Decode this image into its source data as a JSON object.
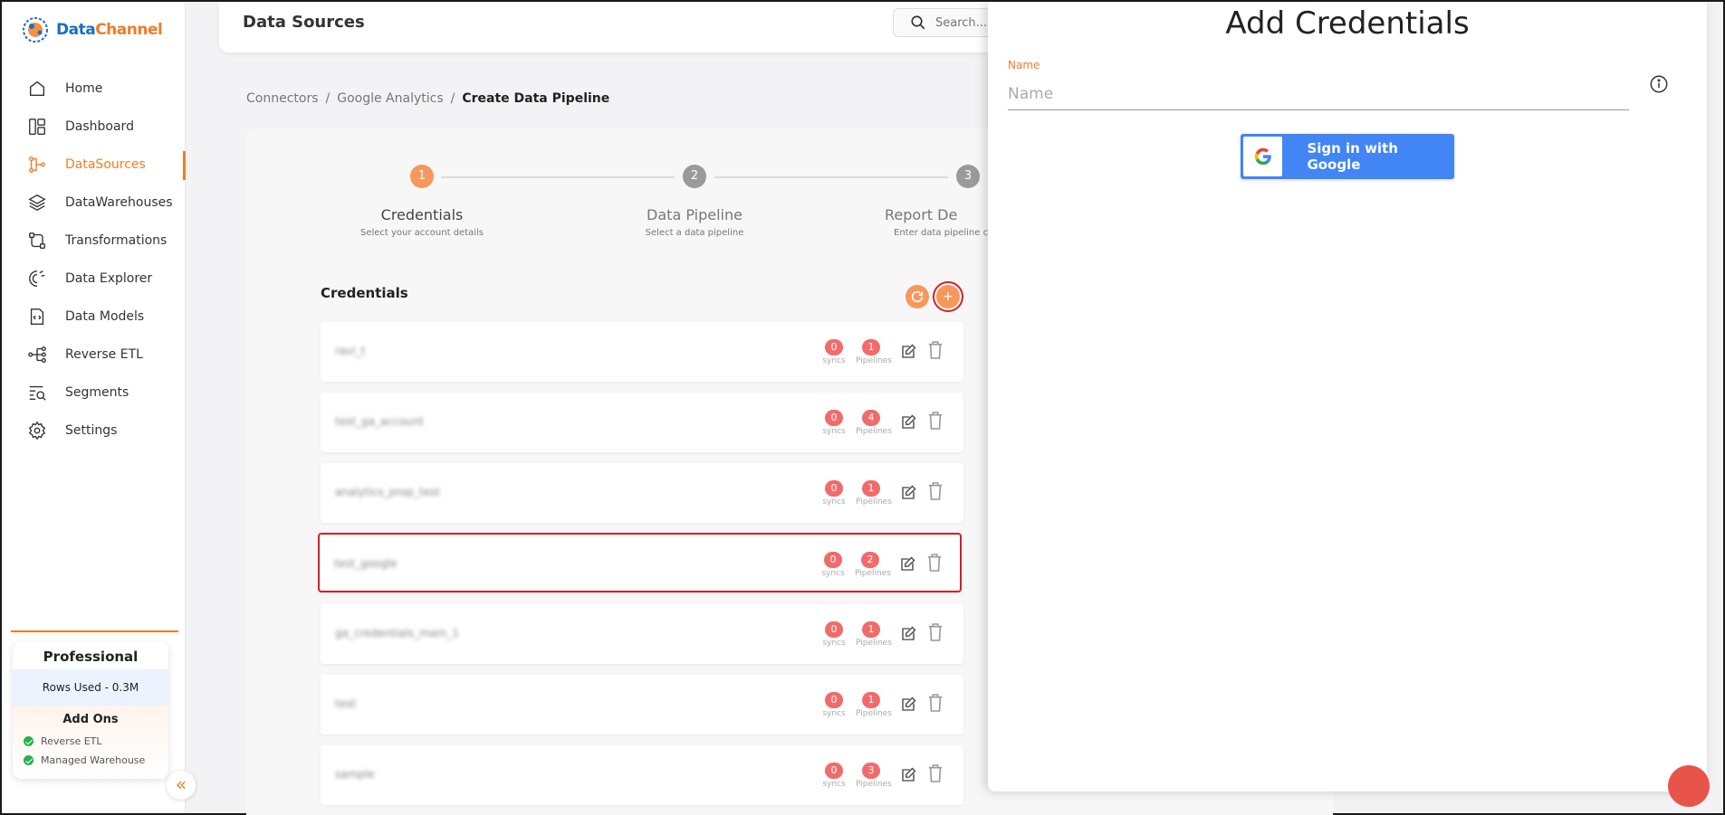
{
  "brand": {
    "name_part1": "Data",
    "name_part2": "Channel"
  },
  "sidebar": {
    "items": [
      {
        "label": "Home",
        "icon": "home-icon"
      },
      {
        "label": "Dashboard",
        "icon": "dashboard-icon"
      },
      {
        "label": "DataSources",
        "icon": "datasources-icon",
        "active": true
      },
      {
        "label": "DataWarehouses",
        "icon": "datawarehouses-icon"
      },
      {
        "label": "Transformations",
        "icon": "transformations-icon"
      },
      {
        "label": "Data Explorer",
        "icon": "data-explorer-icon"
      },
      {
        "label": "Data Models",
        "icon": "data-models-icon"
      },
      {
        "label": "Reverse ETL",
        "icon": "reverse-etl-icon"
      },
      {
        "label": "Segments",
        "icon": "segments-icon"
      },
      {
        "label": "Settings",
        "icon": "settings-icon"
      }
    ],
    "plan": {
      "title": "Professional",
      "rows_used": "Rows Used - 0.3M",
      "addons_title": "Add Ons",
      "addons": [
        "Reverse ETL",
        "Managed Warehouse"
      ]
    },
    "collapse_glyph": "«"
  },
  "header": {
    "title": "Data Sources",
    "search_placeholder": "Search..."
  },
  "breadcrumb": {
    "items": [
      "Connectors",
      "Google Analytics",
      "Create Data Pipeline"
    ],
    "separator": "/"
  },
  "stepper": {
    "steps": [
      {
        "number": "1",
        "label": "Credentials",
        "sub": "Select your account details",
        "active": true
      },
      {
        "number": "2",
        "label": "Data Pipeline",
        "sub": "Select a data pipeline",
        "active": false
      },
      {
        "number": "3",
        "label": "Report De",
        "sub": "Enter data pipeline c",
        "active": false
      }
    ]
  },
  "credentials": {
    "title": "Credentials",
    "add_glyph": "+",
    "syncs_label": "syncs",
    "pipelines_label": "Pipelines",
    "rows": [
      {
        "name": "ravi_t",
        "syncs": "0",
        "pipelines": "1"
      },
      {
        "name": "test_ga_account",
        "syncs": "0",
        "pipelines": "4"
      },
      {
        "name": "analytics_prop_test",
        "syncs": "0",
        "pipelines": "1"
      },
      {
        "name": "test_google",
        "syncs": "0",
        "pipelines": "2",
        "highlight": true
      },
      {
        "name": "ga_credentials_main_1",
        "syncs": "0",
        "pipelines": "1"
      },
      {
        "name": "test",
        "syncs": "0",
        "pipelines": "1"
      },
      {
        "name": "sample",
        "syncs": "0",
        "pipelines": "3"
      }
    ]
  },
  "panel": {
    "title": "Add Credentials",
    "name_label": "Name",
    "name_placeholder": "Name",
    "google_button": "Sign in with Google"
  },
  "colors": {
    "accent": "#f07c27",
    "badge": "#f26b6b",
    "google_blue": "#4285f4",
    "highlight": "#d32029"
  }
}
